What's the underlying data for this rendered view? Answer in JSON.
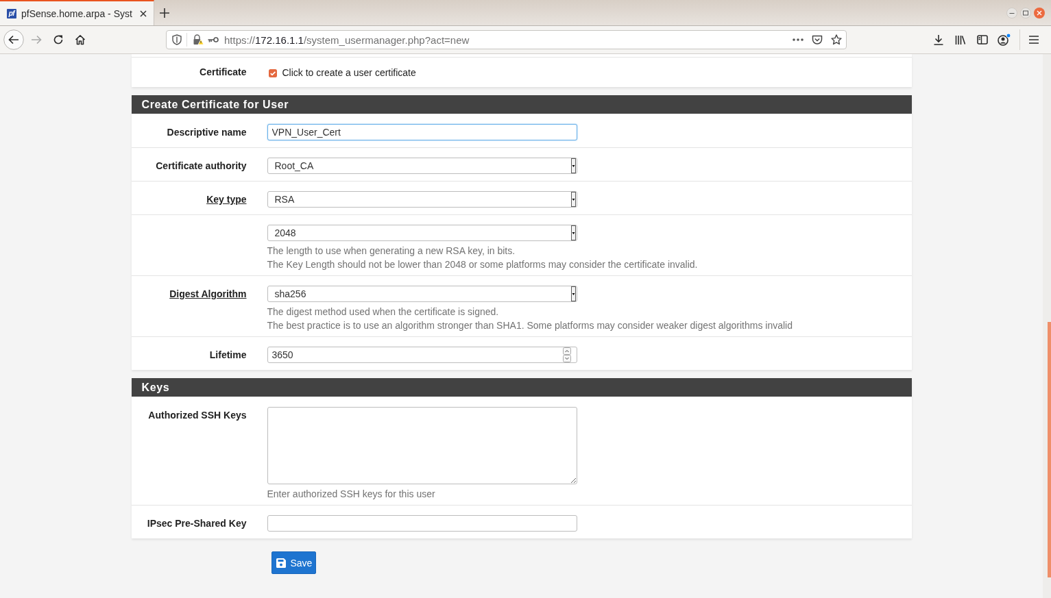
{
  "browser": {
    "tab": {
      "favicon_text": "pf",
      "title": "pfSense.home.arpa - Syst",
      "selected": true
    },
    "address": {
      "scheme": "https://",
      "host": "172.16.1.1",
      "path": "/system_usermanager.php?act=new"
    }
  },
  "sections": [
    {
      "kind": "continued",
      "rows": [
        {
          "kind": "checkbox",
          "label": "Certificate",
          "label_link": false,
          "option": "Click to create a user certificate",
          "checked": true
        }
      ]
    },
    {
      "kind": "titled",
      "title": "Create Certificate for User",
      "rows": [
        {
          "kind": "text",
          "label": "Descriptive name",
          "label_link": false,
          "value": "VPN_User_Cert",
          "focused": true
        },
        {
          "kind": "select",
          "label": "Certificate authority",
          "label_link": false,
          "value": "Root_CA",
          "focused": false
        },
        {
          "kind": "select",
          "label": "Key type",
          "label_link": true,
          "value": "RSA",
          "focused": false
        },
        {
          "kind": "select",
          "value": "2048",
          "focused": false,
          "help": [
            "The length to use when generating a new RSA key, in bits.",
            "The Key Length should not be lower than 2048 or some platforms may consider the certificate invalid."
          ]
        },
        {
          "kind": "select",
          "label": "Digest Algorithm",
          "label_link": true,
          "value": "sha256",
          "focused": false,
          "help": [
            "The digest method used when the certificate is signed.",
            "The best practice is to use an algorithm stronger than SHA1. Some platforms may consider weaker digest algorithms invalid"
          ]
        },
        {
          "kind": "number",
          "label": "Lifetime",
          "label_link": false,
          "value": "3650",
          "focused": false
        }
      ]
    },
    {
      "kind": "titled",
      "title": "Keys",
      "rows": [
        {
          "kind": "textarea",
          "label": "Authorized SSH Keys",
          "label_link": false,
          "focused": false,
          "help": [
            "Enter authorized SSH keys for this user"
          ]
        },
        {
          "kind": "text",
          "label": "IPsec Pre-Shared Key",
          "label_link": false,
          "value": "",
          "focused": false
        }
      ]
    }
  ],
  "save_button": {
    "label": "Save"
  }
}
